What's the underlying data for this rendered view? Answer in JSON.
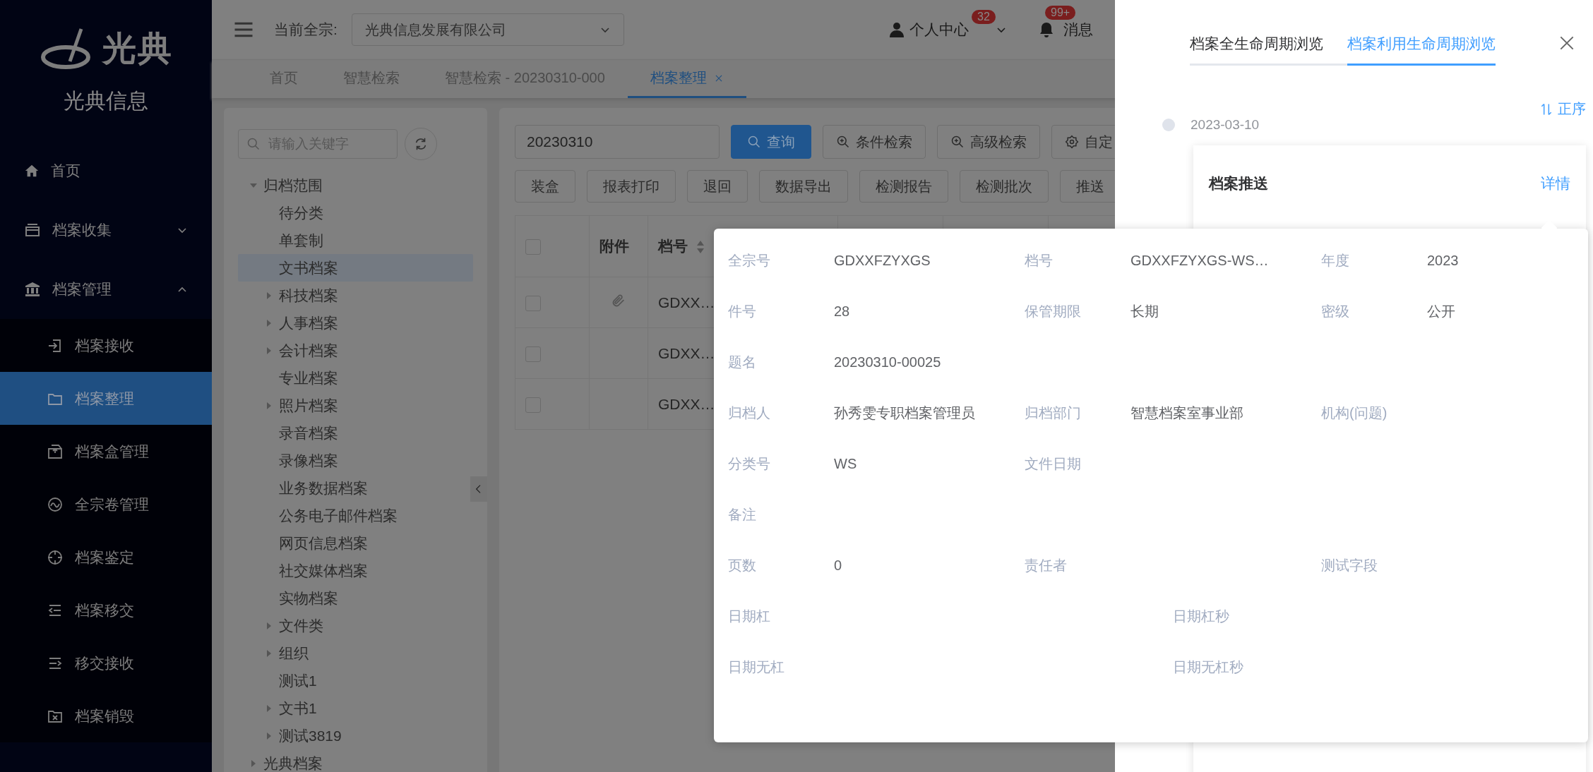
{
  "sidebar": {
    "logo_text": "光典",
    "brand": "光典信息",
    "items": [
      {
        "label": "首页",
        "selected": false
      },
      {
        "label": "档案收集",
        "selected": false,
        "expanded": false
      },
      {
        "label": "档案管理",
        "selected": false,
        "expanded": true,
        "children": [
          {
            "label": "档案接收",
            "selected": false
          },
          {
            "label": "档案整理",
            "selected": true
          },
          {
            "label": "档案盒管理",
            "selected": false
          },
          {
            "label": "全宗卷管理",
            "selected": false
          },
          {
            "label": "档案鉴定",
            "selected": false
          },
          {
            "label": "档案移交",
            "selected": false
          },
          {
            "label": "移交接收",
            "selected": false
          },
          {
            "label": "档案销毁",
            "selected": false
          }
        ]
      }
    ]
  },
  "header": {
    "org_label": "当前全宗:",
    "org_select": "光典信息发展有限公司",
    "user": "个人中心",
    "user_badge": "32",
    "bell_badge": "99+",
    "messages": "消息"
  },
  "tabs": [
    {
      "label": "首页",
      "selected": false,
      "closable": false
    },
    {
      "label": "智慧检索",
      "selected": false,
      "closable": false
    },
    {
      "label": "智慧检索 - 20230310-000",
      "selected": false,
      "closable": false
    },
    {
      "label": "档案整理",
      "selected": true,
      "closable": true
    }
  ],
  "tree_panel": {
    "search": {
      "placeholder": "请输入关键字"
    },
    "tree": [
      {
        "label": "归档范围",
        "kind": "branch",
        "expanded": true,
        "selected": false,
        "children": [
          {
            "label": "待分类",
            "kind": "leaf",
            "selected": false
          },
          {
            "label": "单套制",
            "kind": "leaf",
            "selected": false
          },
          {
            "label": "文书档案",
            "kind": "leaf",
            "selected": true
          },
          {
            "label": "科技档案",
            "kind": "branch",
            "expanded": false,
            "selected": false
          },
          {
            "label": "人事档案",
            "kind": "branch",
            "expanded": false,
            "selected": false
          },
          {
            "label": "会计档案",
            "kind": "branch",
            "expanded": false,
            "selected": false
          },
          {
            "label": "专业档案",
            "kind": "leaf",
            "selected": false
          },
          {
            "label": "照片档案",
            "kind": "branch",
            "expanded": false,
            "selected": false
          },
          {
            "label": "录音档案",
            "kind": "leaf",
            "selected": false
          },
          {
            "label": "录像档案",
            "kind": "leaf",
            "selected": false
          },
          {
            "label": "业务数据档案",
            "kind": "leaf",
            "selected": false
          },
          {
            "label": "公务电子邮件档案",
            "kind": "leaf",
            "selected": false
          },
          {
            "label": "网页信息档案",
            "kind": "leaf",
            "selected": false
          },
          {
            "label": "社交媒体档案",
            "kind": "leaf",
            "selected": false
          },
          {
            "label": "实物档案",
            "kind": "leaf",
            "selected": false
          },
          {
            "label": "文件类",
            "kind": "branch",
            "expanded": false,
            "selected": false
          },
          {
            "label": "组织",
            "kind": "branch",
            "expanded": false,
            "selected": false
          },
          {
            "label": "测试1",
            "kind": "leaf",
            "selected": false
          },
          {
            "label": "文书1",
            "kind": "branch",
            "expanded": false,
            "selected": false
          },
          {
            "label": "测试3819",
            "kind": "branch",
            "expanded": false,
            "selected": false
          }
        ]
      },
      {
        "label": "光典档案",
        "kind": "branch",
        "expanded": false,
        "selected": false
      }
    ]
  },
  "table_panel": {
    "search": {
      "value": "20230310"
    },
    "toolbar": [
      {
        "label": "查询",
        "kind": "primary"
      },
      {
        "label": "条件检索",
        "kind": "default"
      },
      {
        "label": "高级检索",
        "kind": "default"
      },
      {
        "label": "自定",
        "kind": "default"
      }
    ],
    "actions": [
      "装盒",
      "报表打印",
      "退回",
      "数据导出",
      "检测报告",
      "检测批次",
      "推送"
    ],
    "columns": [
      {
        "label": "附件"
      },
      {
        "label": "档号",
        "sortable": true
      }
    ],
    "header_checked": false,
    "rows": [
      {
        "checked": false,
        "attachment": true,
        "code": "GDXX…"
      },
      {
        "checked": false,
        "attachment": false,
        "code": "GDXX…"
      },
      {
        "checked": false,
        "attachment": false,
        "code": "GDXX…"
      }
    ]
  },
  "drawer": {
    "tabs": [
      {
        "label": "档案全生命周期浏览",
        "selected": false
      },
      {
        "label": "档案利用生命周期浏览",
        "selected": true
      }
    ],
    "sort": "正序",
    "timeline": [
      {
        "date": "2023-03-10",
        "title": "档案推送",
        "link": "详情"
      }
    ]
  },
  "popover": {
    "rows": [
      {
        "kind": "thirds",
        "fields": [
          {
            "label": "全宗号",
            "value": "GDXXFZYXGS"
          },
          {
            "label": "档号",
            "value": "GDXXFZYXGS-WS…"
          },
          {
            "label": "年度",
            "value": "2023"
          }
        ]
      },
      {
        "kind": "thirds",
        "fields": [
          {
            "label": "件号",
            "value": "28"
          },
          {
            "label": "保管期限",
            "value": "长期"
          },
          {
            "label": "密级",
            "value": "公开"
          }
        ]
      },
      {
        "kind": "thirds",
        "fields": [
          {
            "label": "题名",
            "value": "20230310-00025"
          }
        ]
      },
      {
        "kind": "thirds",
        "fields": [
          {
            "label": "归档人",
            "value": "孙秀雯专职档案管理员"
          },
          {
            "label": "归档部门",
            "value": "智慧档案室事业部"
          },
          {
            "label": "机构(问题)"
          }
        ]
      },
      {
        "kind": "thirds",
        "fields": [
          {
            "label": "分类号",
            "value": "WS"
          },
          {
            "label": "文件日期"
          }
        ]
      },
      {
        "kind": "thirds",
        "fields": [
          {
            "label": "备注"
          }
        ]
      },
      {
        "kind": "thirds",
        "fields": [
          {
            "label": "页数",
            "value": "0"
          },
          {
            "label": "责任者"
          },
          {
            "label": "测试字段"
          }
        ]
      },
      {
        "kind": "halves",
        "fields": [
          {
            "label": "日期杠"
          },
          {
            "label": "日期杠秒"
          }
        ]
      },
      {
        "kind": "halves",
        "fields": [
          {
            "label": "日期无杠"
          },
          {
            "label": "日期无杠秒"
          }
        ]
      }
    ]
  }
}
